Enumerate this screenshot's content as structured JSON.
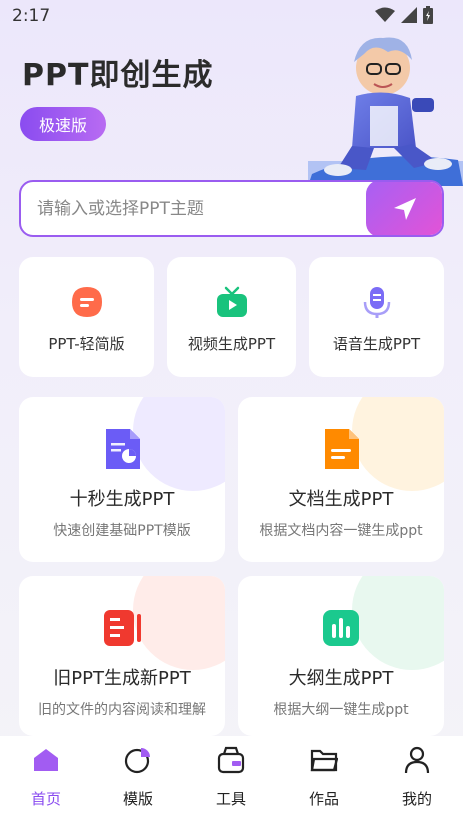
{
  "status_bar": {
    "time": "2:17"
  },
  "header": {
    "title": "PPT即创生成",
    "badge": "极速版"
  },
  "search": {
    "placeholder": "请输入或选择PPT主题"
  },
  "quick_actions": [
    {
      "label": "PPT-轻简版",
      "icon": "ppt-lite-icon",
      "color": "#ff6b4a"
    },
    {
      "label": "视频生成PPT",
      "icon": "tv-icon",
      "color": "#19c37d"
    },
    {
      "label": "语音生成PPT",
      "icon": "microphone-icon",
      "color": "#7b6cf6"
    }
  ],
  "feature_cards": [
    {
      "title": "十秒生成PPT",
      "subtitle": "快速创建基础PPT模版",
      "icon": "slides-doc-icon",
      "color": "#6b5cf6"
    },
    {
      "title": "文档生成PPT",
      "subtitle": "根据文档内容一键生成ppt",
      "icon": "document-icon",
      "color": "#ff8a00"
    },
    {
      "title": "旧PPT生成新PPT",
      "subtitle": "旧的文件的内容阅读和理解",
      "icon": "convert-icon",
      "color": "#f0392f"
    },
    {
      "title": "大纲生成PPT",
      "subtitle": "根据大纲一键生成ppt",
      "icon": "outline-chart-icon",
      "color": "#1bc98e"
    }
  ],
  "bottom_nav": [
    {
      "label": "首页",
      "icon": "home-icon",
      "active": true
    },
    {
      "label": "模版",
      "icon": "template-icon",
      "active": false
    },
    {
      "label": "工具",
      "icon": "toolbox-icon",
      "active": false
    },
    {
      "label": "作品",
      "icon": "folder-icon",
      "active": false
    },
    {
      "label": "我的",
      "icon": "profile-icon",
      "active": false
    }
  ],
  "colors": {
    "accent": "#8a4cf0",
    "accent_pink": "#e453d6"
  }
}
